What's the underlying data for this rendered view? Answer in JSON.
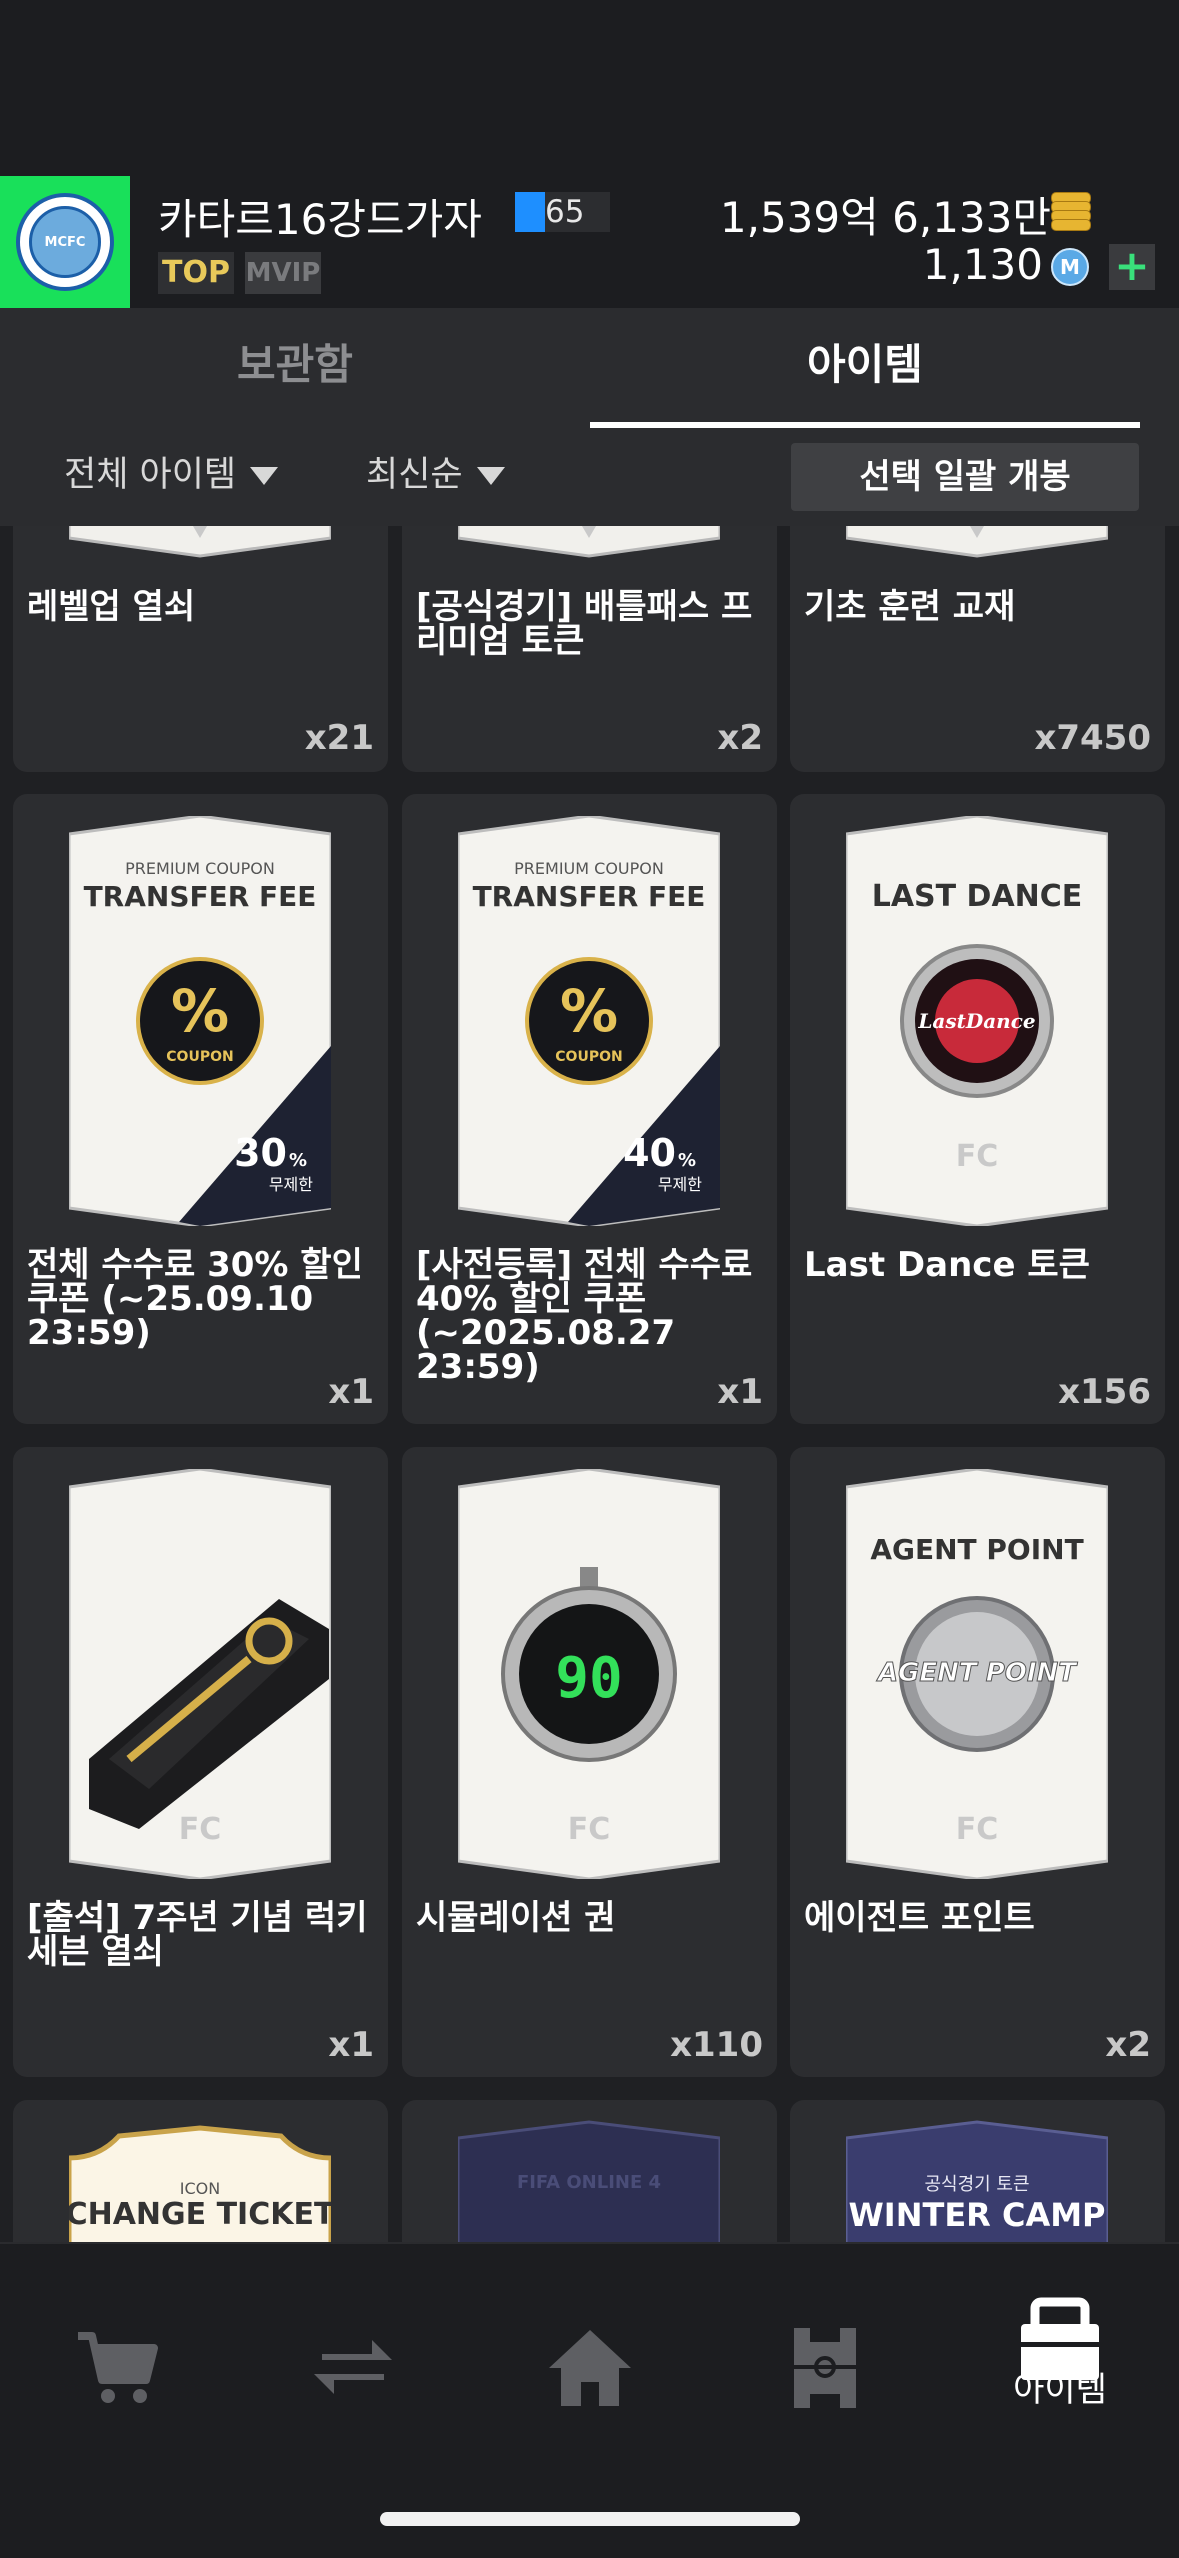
{
  "header": {
    "team_name": "카타르16강드가자",
    "level": "65",
    "badge_top": "TOP",
    "badge_vip": "MVIP",
    "currency_main": "1,539억 6,133만",
    "currency_m": "1,130",
    "crest_text": "MCFC"
  },
  "tabs": [
    {
      "label": "보관함",
      "active": false
    },
    {
      "label": "아이템",
      "active": true
    }
  ],
  "filters": {
    "category": "전체 아이템",
    "sort": "최신순",
    "bulk_open": "선택 일괄 개봉"
  },
  "items": [
    {
      "name": "레벨업 열쇠",
      "qty": "x21"
    },
    {
      "name": "[공식경기] 배틀패스 프리미엄 토큰",
      "qty": "x2"
    },
    {
      "name": "기초 훈련 교재",
      "qty": "x7450"
    },
    {
      "name": "전체 수수료 30% 할인 쿠폰 (~25.09.10 23:59)",
      "qty": "x1",
      "card_sub": "PREMIUM COUPON",
      "card_title": "TRANSFER FEE",
      "badge": "%",
      "badge_sub": "COUPON",
      "discount": "30",
      "discount_unit": "%",
      "discount_note": "무제한"
    },
    {
      "name": "[사전등록] 전체 수수료 40% 할인 쿠폰 (~2025.08.27 23:59)",
      "qty": "x1",
      "card_sub": "PREMIUM COUPON",
      "card_title": "TRANSFER FEE",
      "badge": "%",
      "badge_sub": "COUPON",
      "discount": "40",
      "discount_unit": "%",
      "discount_note": "무제한"
    },
    {
      "name": "Last Dance 토큰",
      "qty": "x156",
      "card_title": "LAST DANCE"
    },
    {
      "name": "[출석] 7주년 기념 럭키 세븐 열쇠",
      "qty": "x1"
    },
    {
      "name": "시뮬레이션 권",
      "qty": "x110",
      "timer": "90"
    },
    {
      "name": "에이전트 포인트",
      "qty": "x2",
      "card_title": "AGENT POINT",
      "coin_text": "AGENT POINT"
    },
    {
      "card_sub": "ICON",
      "card_title": "CHANGE TICKET"
    },
    {
      "card_title": "FIFA ONLINE 4"
    },
    {
      "card_sub": "공식경기 토큰",
      "card_title": "WINTER CAMP"
    }
  ],
  "bottom_nav": {
    "active_label": "아이템",
    "icons": [
      "cart-icon",
      "transfer-icon",
      "home-icon",
      "squad-icon",
      "bag-icon"
    ]
  },
  "colors": {
    "club_bg": "#19e05a",
    "level_fill": "#1e8fff",
    "badge_top": "#e8c95a",
    "plus": "#39e07b"
  }
}
